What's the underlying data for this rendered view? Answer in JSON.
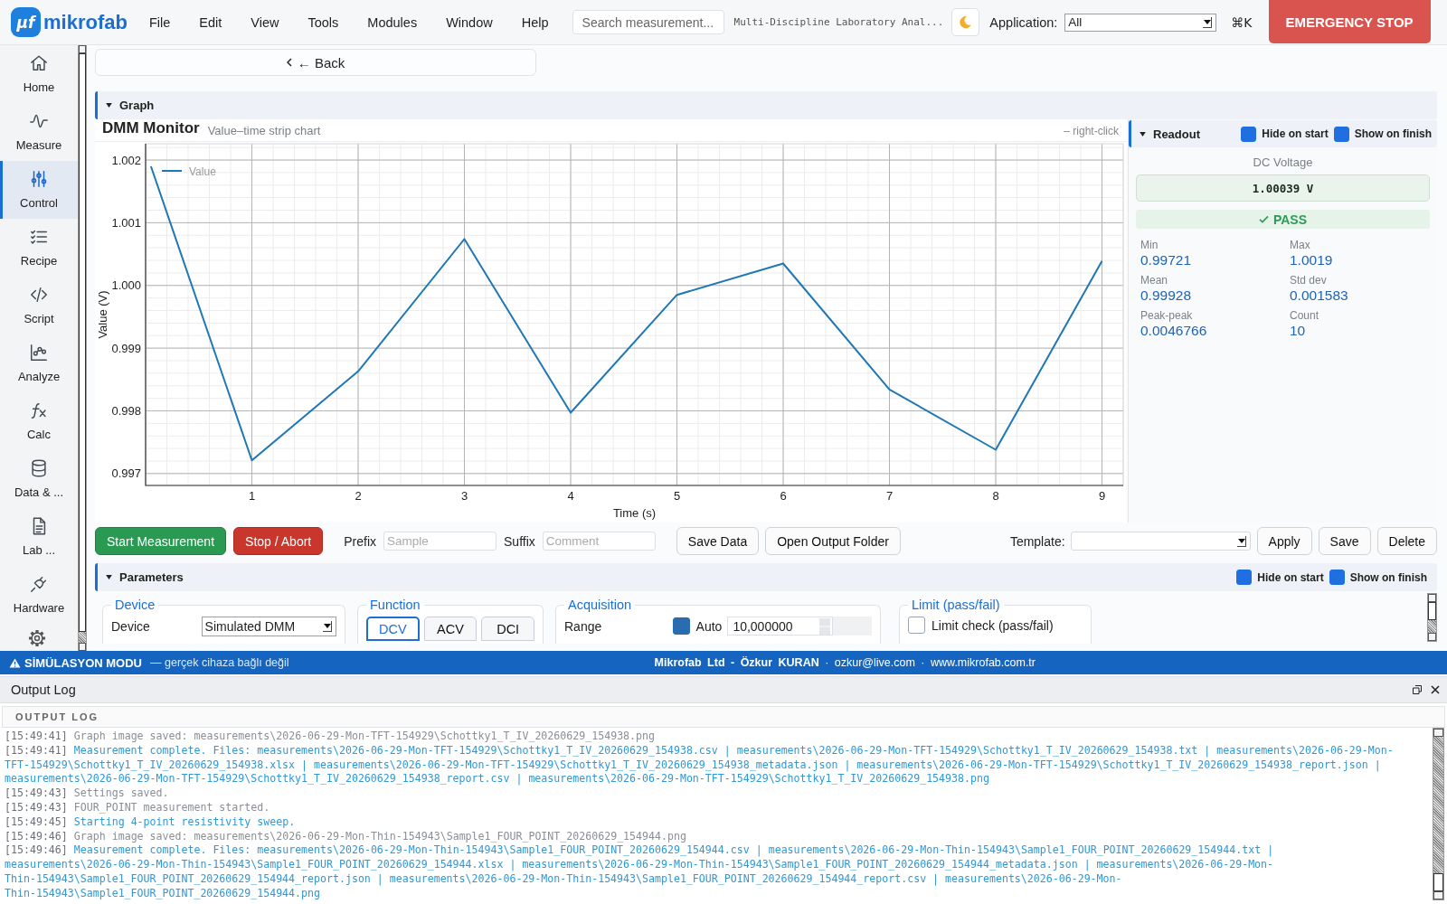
{
  "app": {
    "logo_mark": "µf",
    "logo_text": "mikrofab"
  },
  "menu": [
    "File",
    "Edit",
    "View",
    "Tools",
    "Modules",
    "Window",
    "Help"
  ],
  "search": {
    "placeholder": "Search measurement..."
  },
  "header_info": "Multi-Discipline Laboratory Anal...",
  "application": {
    "label": "Application:",
    "value": "All"
  },
  "shortcut": "⌘K",
  "emergency_button": "EMERGENCY STOP",
  "sidebar": {
    "items": [
      {
        "label": "Home",
        "selected": false
      },
      {
        "label": "Measure",
        "selected": false
      },
      {
        "label": "Control",
        "selected": true
      },
      {
        "label": "Recipe",
        "selected": false
      },
      {
        "label": "Script",
        "selected": false
      },
      {
        "label": "Analyze",
        "selected": false
      },
      {
        "label": "Calc",
        "selected": false
      },
      {
        "label": "Data & ...",
        "selected": false
      },
      {
        "label": "Lab ...",
        "selected": false
      },
      {
        "label": "Hardware",
        "selected": false
      }
    ]
  },
  "back_button": "← Back",
  "graph": {
    "title": "Graph",
    "expanded": true,
    "chart_title": "DMM Monitor",
    "subtitle": "Value–time strip chart",
    "hint": "– right-click",
    "chart_data": {
      "type": "line",
      "grid": true,
      "xlabel": "Time (s)",
      "ylabel": "Value (V)",
      "x": [
        0.05,
        1,
        2,
        3,
        4,
        5,
        6,
        7,
        8,
        9
      ],
      "series": [
        {
          "name": "Value",
          "color": "#1f77b4",
          "values": [
            1.0019,
            0.99721,
            0.99863,
            1.00074,
            0.99797,
            0.99985,
            1.00035,
            0.99834,
            0.99738,
            1.00039
          ]
        }
      ],
      "xlim": [
        0,
        9.2
      ],
      "ylim": [
        0.99681,
        1.00226
      ],
      "xticks": [
        1,
        2,
        3,
        4,
        5,
        6,
        7,
        8,
        9
      ],
      "yticks": [
        {
          "value": 0.997,
          "label": "0.997"
        },
        {
          "value": 0.998,
          "label": "0.998"
        },
        {
          "value": 0.999,
          "label": "0.999"
        },
        {
          "value": 1.0,
          "label": "1.000"
        },
        {
          "value": 1.001,
          "label": "1.001"
        },
        {
          "value": 1.002,
          "label": "1.002"
        }
      ]
    }
  },
  "readout": {
    "title": "Readout",
    "expanded": true,
    "options": [
      {
        "label": "Hide on start",
        "checked": true
      },
      {
        "label": "Show on finish",
        "checked": true
      }
    ],
    "quantity": "DC Voltage",
    "value": "1.00039 V",
    "verdict": {
      "label": "PASS",
      "passed": true
    },
    "stats": [
      {
        "label": "Min",
        "value": "0.99721"
      },
      {
        "label": "Max",
        "value": "1.0019"
      },
      {
        "label": "Mean",
        "value": "0.99928"
      },
      {
        "label": "Std dev",
        "value": "0.001583"
      },
      {
        "label": "Peak-peak",
        "value": "0.0046766"
      },
      {
        "label": "Count",
        "value": "10"
      }
    ]
  },
  "toolbar": {
    "start_button": "Start Measurement",
    "stop_button": "Stop / Abort",
    "prefix": {
      "label": "Prefix",
      "placeholder": "Sample"
    },
    "suffix": {
      "label": "Suffix",
      "placeholder": "Comment"
    },
    "save_data_button": "Save Data",
    "open_folder_button": "Open Output Folder",
    "template": {
      "label": "Template:"
    },
    "template_buttons": [
      "Apply",
      "Save",
      "Delete"
    ]
  },
  "parameters": {
    "title": "Parameters",
    "expanded": true,
    "options": [
      {
        "label": "Hide on start",
        "checked": true
      },
      {
        "label": "Show on finish",
        "checked": true
      }
    ],
    "groups": [
      {
        "kind": "device",
        "title": "Device",
        "label": "Device",
        "value": "Simulated DMM"
      },
      {
        "kind": "function",
        "title": "Function",
        "tabs": [
          {
            "label": "DCV",
            "selected": true
          },
          {
            "label": "ACV",
            "selected": false
          },
          {
            "label": "DCI",
            "selected": false
          }
        ]
      },
      {
        "kind": "acquisition",
        "title": "Acquisition",
        "label": "Range",
        "auto": {
          "label": "Auto",
          "checked": true
        },
        "value": "10,000000"
      },
      {
        "kind": "limit",
        "title": "Limit (pass/fail)",
        "check": {
          "label": "Limit check (pass/fail)",
          "checked": false
        }
      }
    ]
  },
  "status_bar": {
    "mode": "SİMÜLASYON MODU",
    "note": "— gerçek cihaza bağlı değil",
    "credits": "**Mikrofab Ltd - Özkur KURAN** · ozkur@live.com · www.mikrofab.com.tr"
  },
  "output_log": {
    "title": "Output Log",
    "heading": "OUTPUT LOG",
    "entries": [
      {
        "time": "[15:49:41]",
        "text": "Graph image saved: measurements\\2026-06-29-Mon-TFT-154929\\Schottky1_T_IV_20260629_154938.png",
        "kind": "info"
      },
      {
        "time": "[15:49:41]",
        "text": "Measurement complete. Files: measurements\\2026-06-29-Mon-TFT-154929\\Schottky1_T_IV_20260629_154938.csv | measurements\\2026-06-29-Mon-TFT-154929\\Schottky1_T_IV_20260629_154938.txt | measurements\\2026-06-29-Mon-TFT-154929\\Schottky1_T_IV_20260629_154938.xlsx | measurements\\2026-06-29-Mon-TFT-154929\\Schottky1_T_IV_20260629_154938_metadata.json | measurements\\2026-06-29-Mon-TFT-154929\\Schottky1_T_IV_20260629_154938_report.json | measurements\\2026-06-29-Mon-TFT-154929\\Schottky1_T_IV_20260629_154938_report.csv | measurements\\2026-06-29-Mon-TFT-154929\\Schottky1_T_IV_20260629_154938.png",
        "kind": "accent"
      },
      {
        "time": "[15:49:43]",
        "text": "Settings saved.",
        "kind": "info"
      },
      {
        "time": "[15:49:43]",
        "text": "FOUR_POINT measurement started.",
        "kind": "info"
      },
      {
        "time": "[15:49:45]",
        "text": "Starting 4-point resistivity sweep.",
        "kind": "accent"
      },
      {
        "time": "[15:49:46]",
        "text": "Graph image saved: measurements\\2026-06-29-Mon-Thin-154943\\Sample1_FOUR_POINT_20260629_154944.png",
        "kind": "info"
      },
      {
        "time": "[15:49:46]",
        "text": "Measurement complete. Files: measurements\\2026-06-29-Mon-Thin-154943\\Sample1_FOUR_POINT_20260629_154944.csv | measurements\\2026-06-29-Mon-Thin-154943\\Sample1_FOUR_POINT_20260629_154944.txt | measurements\\2026-06-29-Mon-Thin-154943\\Sample1_FOUR_POINT_20260629_154944.xlsx | measurements\\2026-06-29-Mon-Thin-154943\\Sample1_FOUR_POINT_20260629_154944_metadata.json | measurements\\2026-06-29-Mon-Thin-154943\\Sample1_FOUR_POINT_20260629_154944_report.json | measurements\\2026-06-29-Mon-Thin-154943\\Sample1_FOUR_POINT_20260629_154944_report.csv | measurements\\2026-06-29-Mon-Thin-154943\\Sample1_FOUR_POINT_20260629_154944.png",
        "kind": "accent"
      }
    ]
  }
}
